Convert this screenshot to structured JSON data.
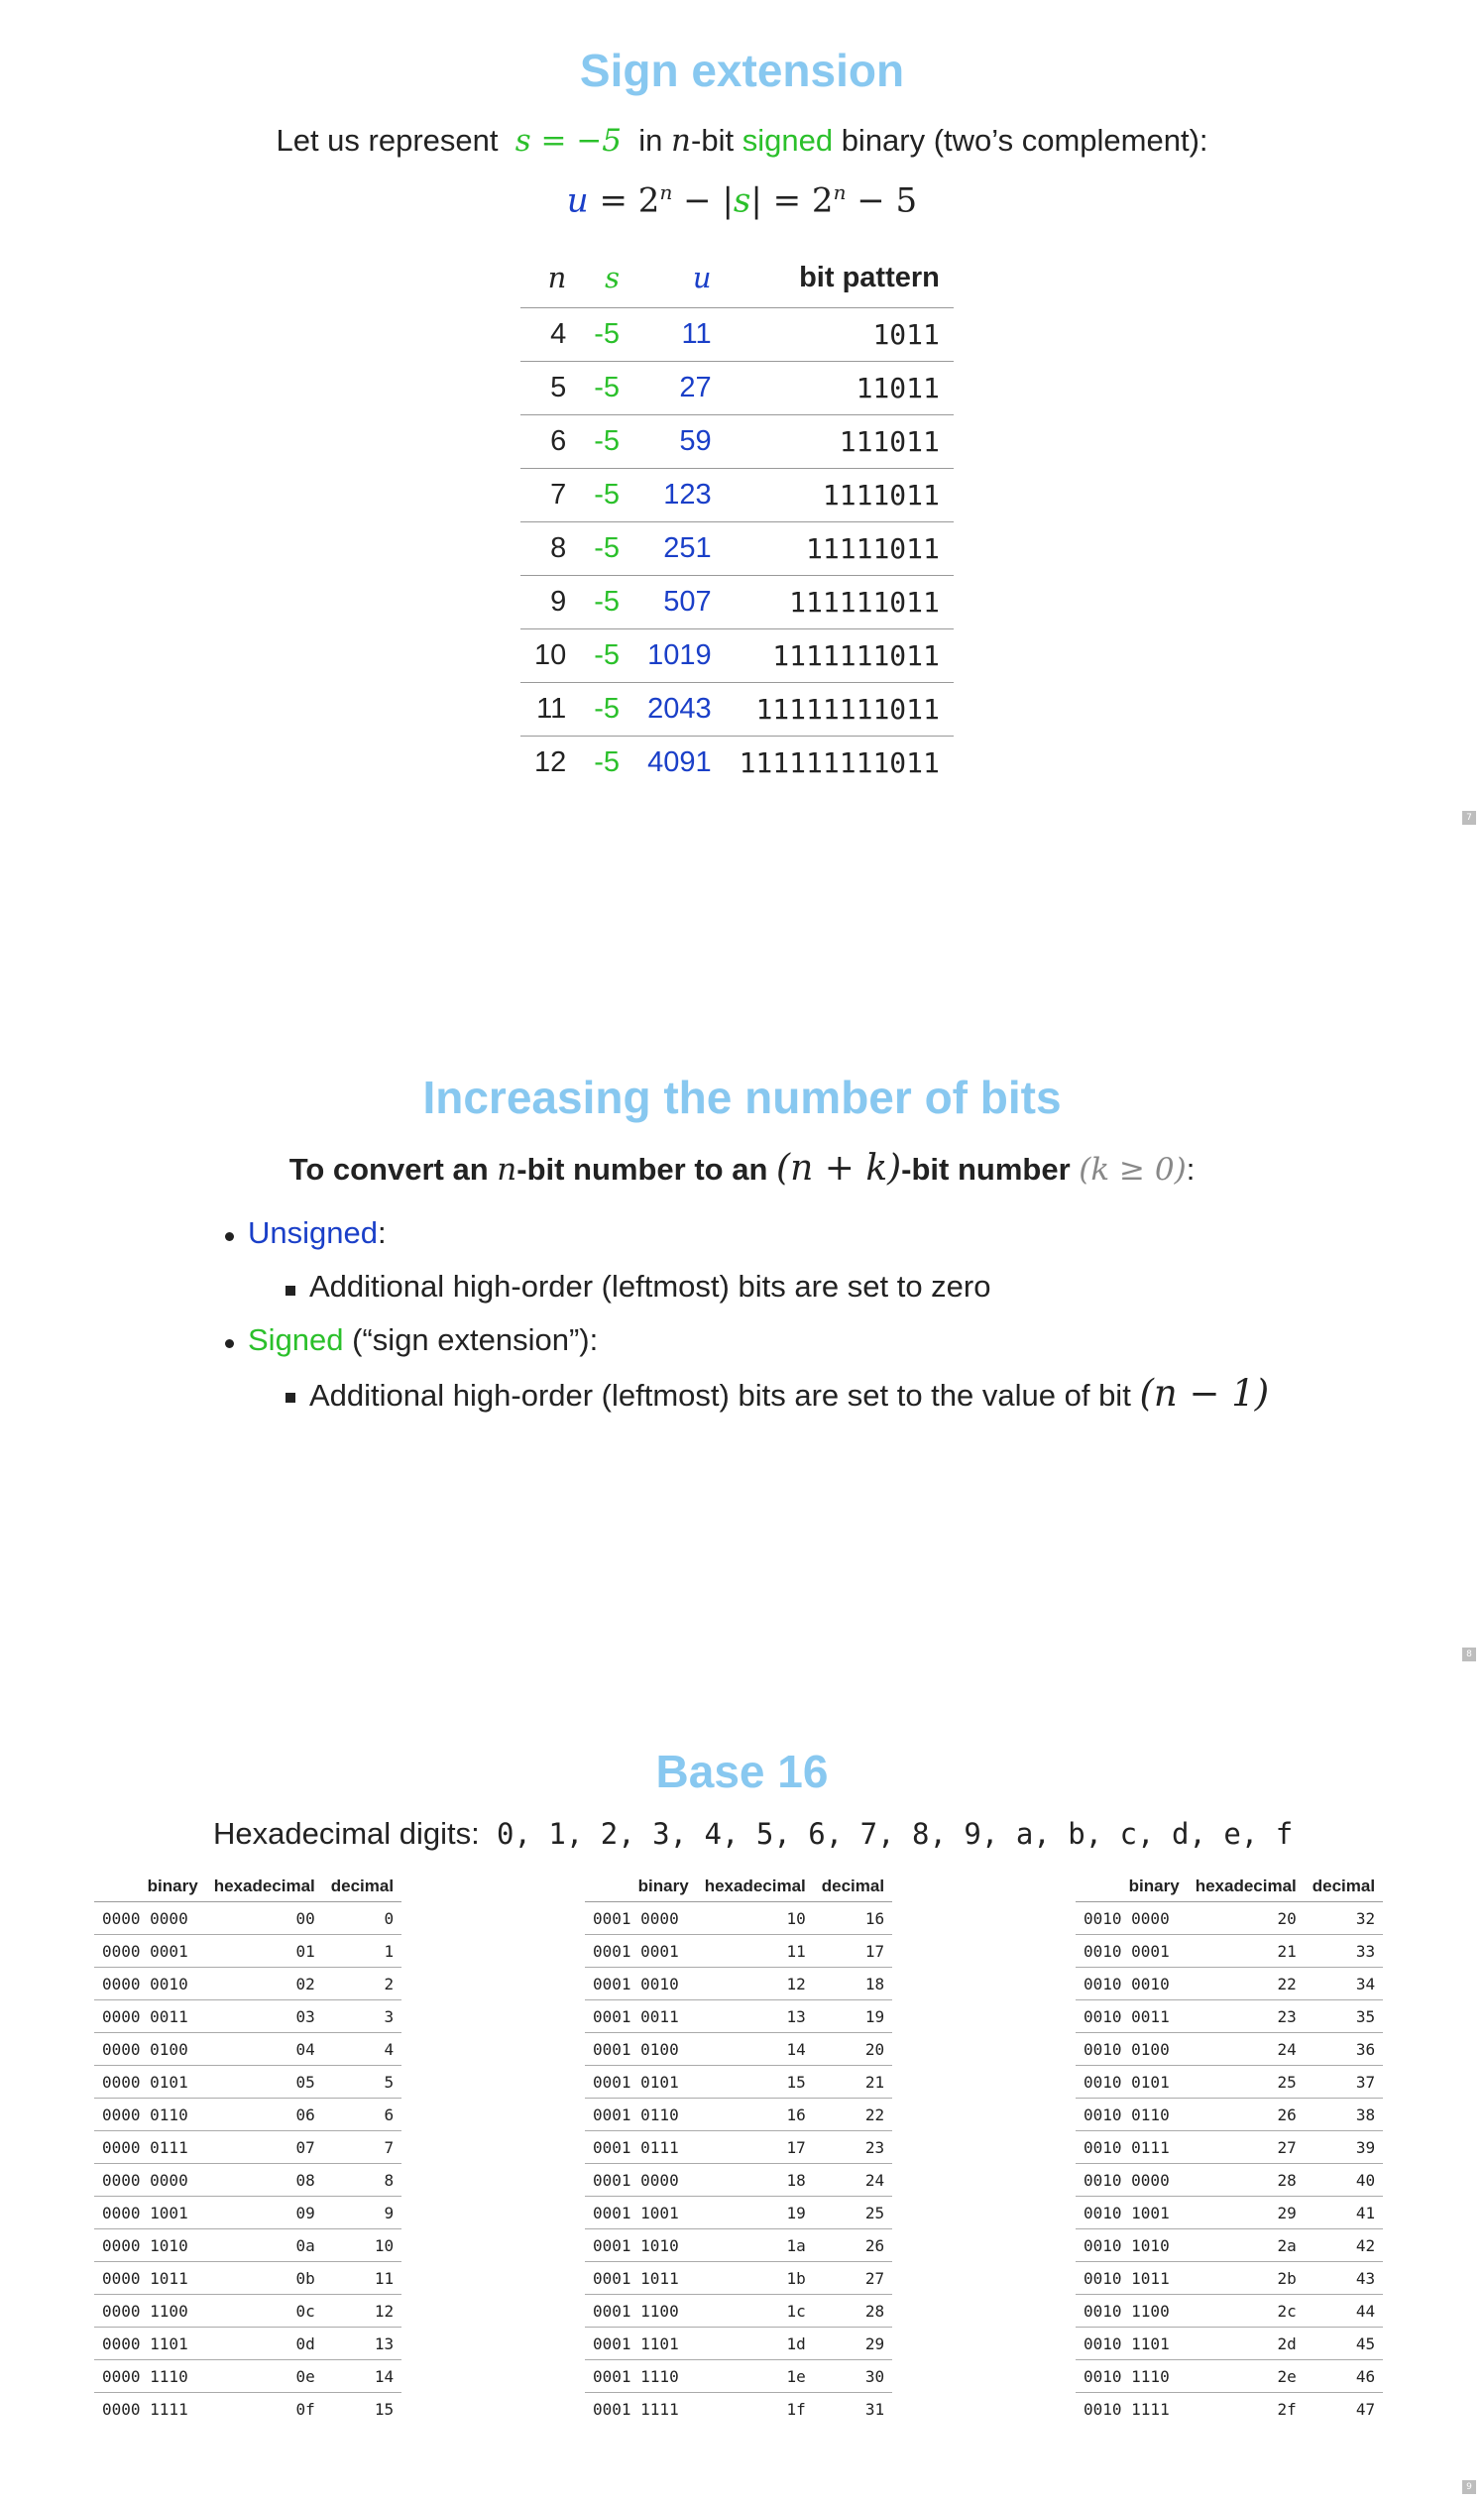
{
  "slide1": {
    "title": "Sign extension",
    "intro": {
      "prefix": "Let us represent",
      "math_s": "s = −5",
      "in": "in",
      "n": "n",
      "bit": "-bit",
      "signed": "signed",
      "suffix": "binary (two’s complement):"
    },
    "formula": {
      "u": "u",
      "eq1": " = 2",
      "exp1": "n",
      "minus": " − |",
      "s": "s",
      "eq2": "| = 2",
      "exp2": "n",
      "tail": " − 5"
    },
    "table": {
      "headers": [
        "n",
        "s",
        "u",
        "bit pattern"
      ],
      "rows": [
        [
          "4",
          "-5",
          "11",
          "1011"
        ],
        [
          "5",
          "-5",
          "27",
          "11011"
        ],
        [
          "6",
          "-5",
          "59",
          "111011"
        ],
        [
          "7",
          "-5",
          "123",
          "1111011"
        ],
        [
          "8",
          "-5",
          "251",
          "11111011"
        ],
        [
          "9",
          "-5",
          "507",
          "111111011"
        ],
        [
          "10",
          "-5",
          "1019",
          "1111111011"
        ],
        [
          "11",
          "-5",
          "2043",
          "11111111011"
        ],
        [
          "12",
          "-5",
          "4091",
          "111111111011"
        ]
      ]
    },
    "page": "7"
  },
  "slide2": {
    "title": "Increasing the number of bits",
    "convert": {
      "a": "To convert an",
      "n": "n",
      "b": "-bit number to an",
      "nk": "(n + k)",
      "c": "-bit number",
      "cond": "(k ≥ 0)",
      "colon": ":"
    },
    "unsigned_label": "Unsigned",
    "unsigned_colon": ":",
    "unsigned_item": "Additional high-order (leftmost) bits are set to zero",
    "signed_label": "Signed",
    "signed_rest": "(“sign extension”):",
    "signed_item": "Additional high-order (leftmost) bits are set to the value of bit",
    "signed_item_math": "(n − 1)",
    "page": "8"
  },
  "slide3": {
    "title": "Base 16",
    "digits_label": "Hexadecimal digits:",
    "digits": "0, 1, 2, 3, 4, 5, 6, 7, 8, 9, a, b, c, d, e, f",
    "headers": [
      "binary",
      "hexadecimal",
      "decimal"
    ],
    "tables": [
      [
        [
          "0000 0000",
          "00",
          "0"
        ],
        [
          "0000 0001",
          "01",
          "1"
        ],
        [
          "0000 0010",
          "02",
          "2"
        ],
        [
          "0000 0011",
          "03",
          "3"
        ],
        [
          "0000 0100",
          "04",
          "4"
        ],
        [
          "0000 0101",
          "05",
          "5"
        ],
        [
          "0000 0110",
          "06",
          "6"
        ],
        [
          "0000 0111",
          "07",
          "7"
        ],
        [
          "0000 0000",
          "08",
          "8"
        ],
        [
          "0000 1001",
          "09",
          "9"
        ],
        [
          "0000 1010",
          "0a",
          "10"
        ],
        [
          "0000 1011",
          "0b",
          "11"
        ],
        [
          "0000 1100",
          "0c",
          "12"
        ],
        [
          "0000 1101",
          "0d",
          "13"
        ],
        [
          "0000 1110",
          "0e",
          "14"
        ],
        [
          "0000 1111",
          "0f",
          "15"
        ]
      ],
      [
        [
          "0001 0000",
          "10",
          "16"
        ],
        [
          "0001 0001",
          "11",
          "17"
        ],
        [
          "0001 0010",
          "12",
          "18"
        ],
        [
          "0001 0011",
          "13",
          "19"
        ],
        [
          "0001 0100",
          "14",
          "20"
        ],
        [
          "0001 0101",
          "15",
          "21"
        ],
        [
          "0001 0110",
          "16",
          "22"
        ],
        [
          "0001 0111",
          "17",
          "23"
        ],
        [
          "0001 0000",
          "18",
          "24"
        ],
        [
          "0001 1001",
          "19",
          "25"
        ],
        [
          "0001 1010",
          "1a",
          "26"
        ],
        [
          "0001 1011",
          "1b",
          "27"
        ],
        [
          "0001 1100",
          "1c",
          "28"
        ],
        [
          "0001 1101",
          "1d",
          "29"
        ],
        [
          "0001 1110",
          "1e",
          "30"
        ],
        [
          "0001 1111",
          "1f",
          "31"
        ]
      ],
      [
        [
          "0010 0000",
          "20",
          "32"
        ],
        [
          "0010 0001",
          "21",
          "33"
        ],
        [
          "0010 0010",
          "22",
          "34"
        ],
        [
          "0010 0011",
          "23",
          "35"
        ],
        [
          "0010 0100",
          "24",
          "36"
        ],
        [
          "0010 0101",
          "25",
          "37"
        ],
        [
          "0010 0110",
          "26",
          "38"
        ],
        [
          "0010 0111",
          "27",
          "39"
        ],
        [
          "0010 0000",
          "28",
          "40"
        ],
        [
          "0010 1001",
          "29",
          "41"
        ],
        [
          "0010 1010",
          "2a",
          "42"
        ],
        [
          "0010 1011",
          "2b",
          "43"
        ],
        [
          "0010 1100",
          "2c",
          "44"
        ],
        [
          "0010 1101",
          "2d",
          "45"
        ],
        [
          "0010 1110",
          "2e",
          "46"
        ],
        [
          "0010 1111",
          "2f",
          "47"
        ]
      ]
    ],
    "page": "9"
  }
}
